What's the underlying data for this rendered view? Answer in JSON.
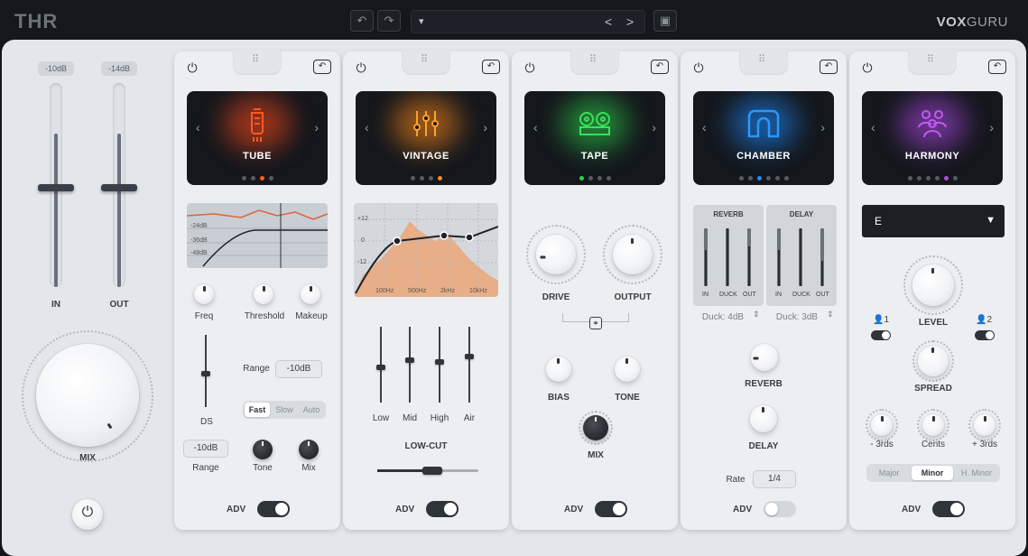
{
  "topbar": {
    "logo": "THR",
    "brand_bold": "VOX",
    "brand_light": "GURU",
    "undo_symbol": "↶",
    "redo_symbol": "↷",
    "save_symbol": "▣",
    "preset_dropdown_symbol": "▾",
    "prev_symbol": "<",
    "next_symbol": ">"
  },
  "global": {
    "in_value": "-10dB",
    "out_value": "-14dB",
    "in_label": "IN",
    "out_label": "OUT",
    "mix_label": "MIX",
    "power_symbol": "⏻"
  },
  "common": {
    "power_symbol": "⏻",
    "undo_symbol": "↶",
    "prev_symbol": "‹",
    "next_symbol": "›",
    "adv_label": "ADV"
  },
  "modules": {
    "tube": {
      "name": "TUBE",
      "accent": "#ff4a1c",
      "adv_on": true,
      "freq_label": "Freq",
      "threshold_label": "Threshold",
      "makeup_label": "Makeup",
      "range_label": "Range",
      "range_value": "-10dB",
      "ds_label": "DS",
      "speed_options": [
        "Fast",
        "Slow",
        "Auto"
      ],
      "speed_selected": "Fast",
      "range2_value": "-10dB",
      "range2_label": "Range",
      "tone_label": "Tone",
      "mix_label": "Mix",
      "graph_labels": [
        "-24dB",
        "-36dB",
        "-48dB"
      ]
    },
    "vintage": {
      "name": "VINTAGE",
      "accent": "#ff8a1a",
      "adv_on": true,
      "eq_db_labels": [
        "+12",
        "0",
        "-12"
      ],
      "eq_freq_labels": [
        "100Hz",
        "500Hz",
        "2kHz",
        "10kHz"
      ],
      "sliders": [
        "Low",
        "Mid",
        "High",
        "Air"
      ],
      "lowcut_label": "LOW-CUT"
    },
    "tape": {
      "name": "TAPE",
      "accent": "#2fd14a",
      "adv_on": true,
      "drive_label": "DRIVE",
      "output_label": "OUTPUT",
      "bias_label": "BIAS",
      "tone_label": "TONE",
      "mix_label": "MIX"
    },
    "chamber": {
      "name": "CHAMBER",
      "accent": "#1f8bff",
      "adv_on": false,
      "reverb_header": "REVERB",
      "delay_header": "DELAY",
      "meter_labels": [
        "IN",
        "DUCK",
        "OUT"
      ],
      "duck_reverb": "Duck: 4dB",
      "duck_delay": "Duck: 3dB",
      "reverb_label": "REVERB",
      "delay_label": "DELAY",
      "rate_label": "Rate",
      "rate_value": "1/4"
    },
    "harmony": {
      "name": "HARMONY",
      "accent": "#b04ae8",
      "adv_on": true,
      "key_value": "E",
      "level_label": "LEVEL",
      "voice1_label": "1",
      "voice2_label": "2",
      "spread_label": "SPREAD",
      "minus_label": "- 3rds",
      "cents_label": "Cents",
      "plus_label": "+ 3rds",
      "scale_options": [
        "Major",
        "Minor",
        "H. Minor"
      ],
      "scale_selected": "Minor"
    }
  }
}
